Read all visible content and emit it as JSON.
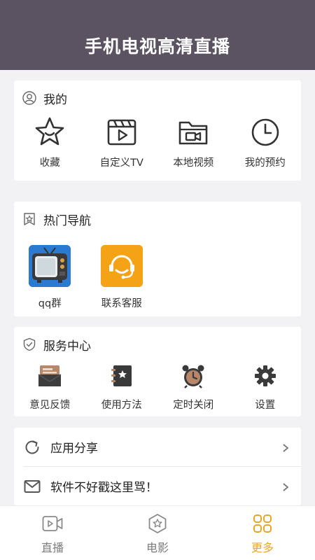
{
  "header": {
    "title": "手机电视高清直播"
  },
  "mine": {
    "title": "我的",
    "items": [
      {
        "label": "收藏",
        "icon": "star-icon"
      },
      {
        "label": "自定义TV",
        "icon": "clapperboard-icon"
      },
      {
        "label": "本地视频",
        "icon": "folder-video-icon"
      },
      {
        "label": "我的预约",
        "icon": "clock-icon"
      }
    ]
  },
  "hot_nav": {
    "title": "热门导航",
    "items": [
      {
        "label": "qq群",
        "icon": "tv-icon"
      },
      {
        "label": "联系客服",
        "icon": "headset-icon"
      }
    ]
  },
  "service": {
    "title": "服务中心",
    "items": [
      {
        "label": "意见反馈",
        "icon": "feedback-icon"
      },
      {
        "label": "使用方法",
        "icon": "guide-book-icon"
      },
      {
        "label": "定时关闭",
        "icon": "alarm-clock-icon"
      },
      {
        "label": "设置",
        "icon": "gear-icon"
      }
    ]
  },
  "list": {
    "items": [
      {
        "label": "应用分享",
        "icon": "share-refresh-icon"
      },
      {
        "label": "软件不好戳这里骂！",
        "icon": "mail-icon"
      }
    ]
  },
  "tabbar": {
    "items": [
      {
        "label": "直播",
        "icon": "video-camera-icon",
        "active": false
      },
      {
        "label": "电影",
        "icon": "movie-badge-icon",
        "active": false
      },
      {
        "label": "更多",
        "icon": "grid-more-icon",
        "active": true
      }
    ]
  },
  "colors": {
    "header_bg": "#5c5362",
    "accent": "#e8a72c",
    "page_bg": "#f2f2f4"
  }
}
